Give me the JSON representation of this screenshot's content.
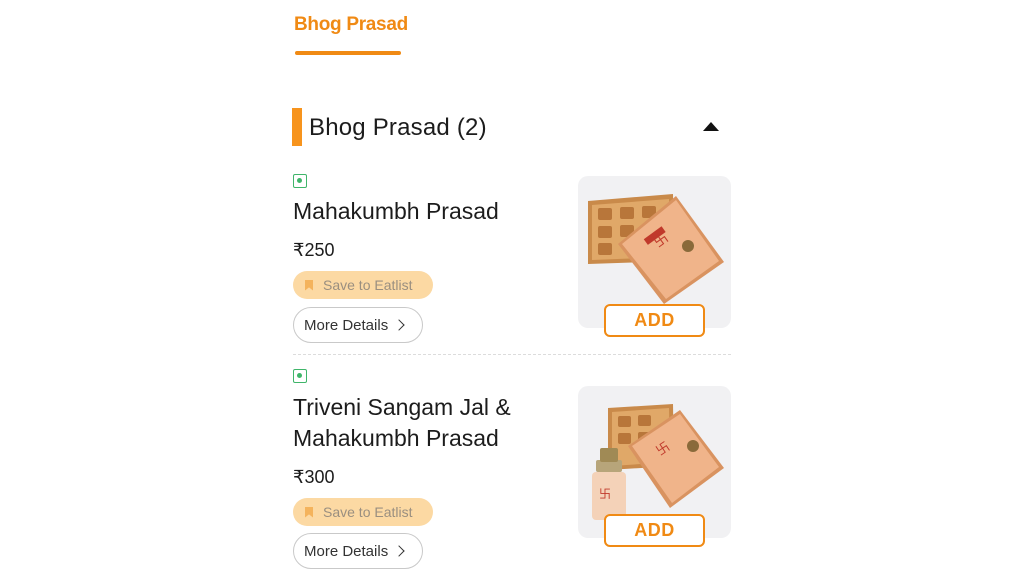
{
  "tab": {
    "label": "Bhog Prasad"
  },
  "section": {
    "title": "Bhog Prasad (2)"
  },
  "items": [
    {
      "name": "Mahakumbh Prasad",
      "price": "₹250",
      "save_label": "Save to Eatlist",
      "details_label": "More Details",
      "add_label": "ADD"
    },
    {
      "name": "Triveni Sangam Jal & Mahakumbh Prasad",
      "price": "₹300",
      "save_label": "Save to Eatlist",
      "details_label": "More Details",
      "add_label": "ADD"
    }
  ]
}
